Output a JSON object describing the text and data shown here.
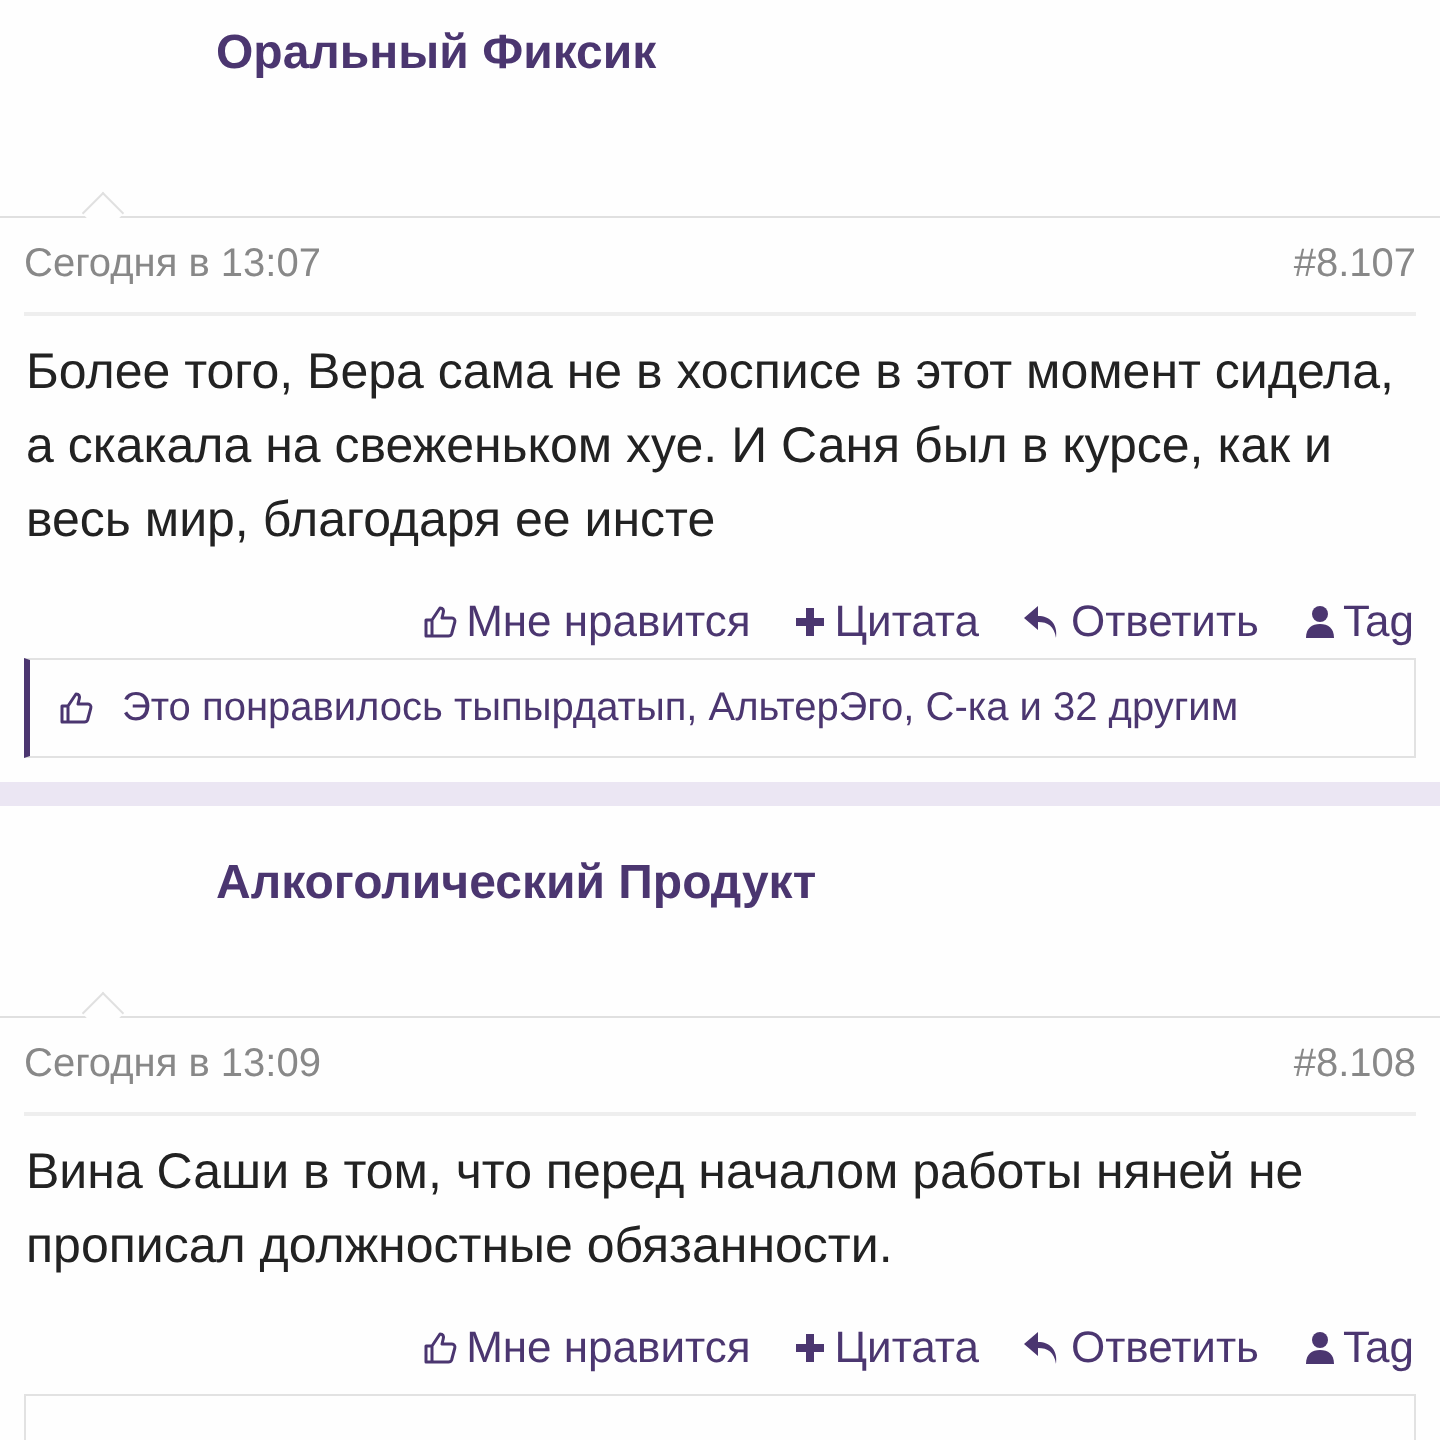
{
  "posts": [
    {
      "author": "Оральный Фиксик",
      "date": "Сегодня в 13:07",
      "number": "#8.107",
      "text": "Более того, Вера сама не в хосписе в этот момент сидела, а скакала на свеженьком хуе. И Саня был в курсе, как и весь мир, благодаря ее инсте",
      "actions": [
        {
          "kind": "like",
          "label": "Мне нравится"
        },
        {
          "kind": "quote",
          "label": "Цитата"
        },
        {
          "kind": "reply",
          "label": "Ответить"
        },
        {
          "kind": "tag",
          "label": "Tag"
        }
      ],
      "likes": "Это понравилось тыпырдатып, АльтерЭго, С-ка и 32 другим"
    },
    {
      "author": "Алкоголический Продукт",
      "date": "Сегодня в 13:09",
      "number": "#8.108",
      "text": "Вина Саши в том, что перед началом работы няней не прописал должностные обязанности.",
      "actions": [
        {
          "kind": "like",
          "label": "Мне нравится"
        },
        {
          "kind": "quote",
          "label": "Цитата"
        },
        {
          "kind": "reply",
          "label": "Ответить"
        },
        {
          "kind": "tag",
          "label": "Tag"
        }
      ]
    }
  ]
}
